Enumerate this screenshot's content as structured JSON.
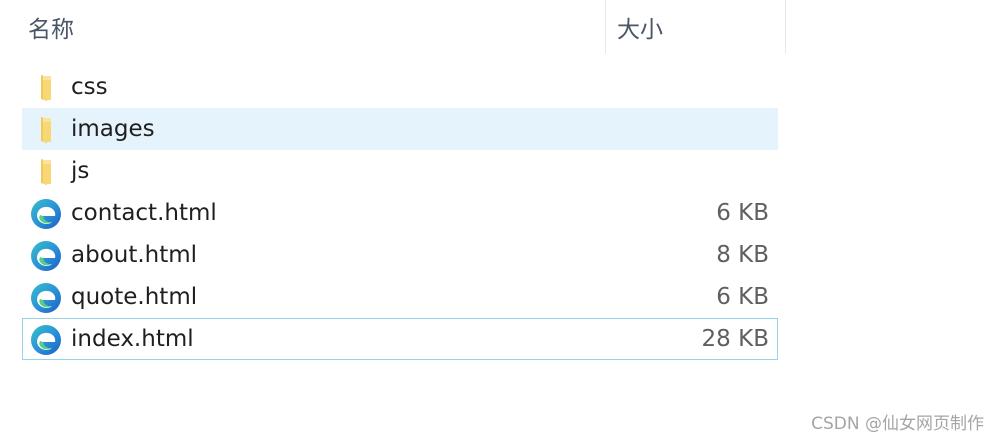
{
  "columns": {
    "name": "名称",
    "size": "大小"
  },
  "files": [
    {
      "name": "css",
      "size": "",
      "icon": "folder-icon",
      "state": "normal"
    },
    {
      "name": "images",
      "size": "",
      "icon": "folder-icon",
      "state": "hovered"
    },
    {
      "name": "js",
      "size": "",
      "icon": "folder-icon",
      "state": "normal"
    },
    {
      "name": "contact.html",
      "size": "6 KB",
      "icon": "edge-html-icon",
      "state": "normal"
    },
    {
      "name": "about.html",
      "size": "8 KB",
      "icon": "edge-html-icon",
      "state": "normal"
    },
    {
      "name": "quote.html",
      "size": "6 KB",
      "icon": "edge-html-icon",
      "state": "normal"
    },
    {
      "name": "index.html",
      "size": "28 KB",
      "icon": "edge-html-icon",
      "state": "focused"
    }
  ],
  "watermark": "CSDN @仙女网页制作",
  "colors": {
    "hover_bg": "#e5f3fd",
    "focus_border": "#99d1ea",
    "folder": "#f8d775"
  }
}
